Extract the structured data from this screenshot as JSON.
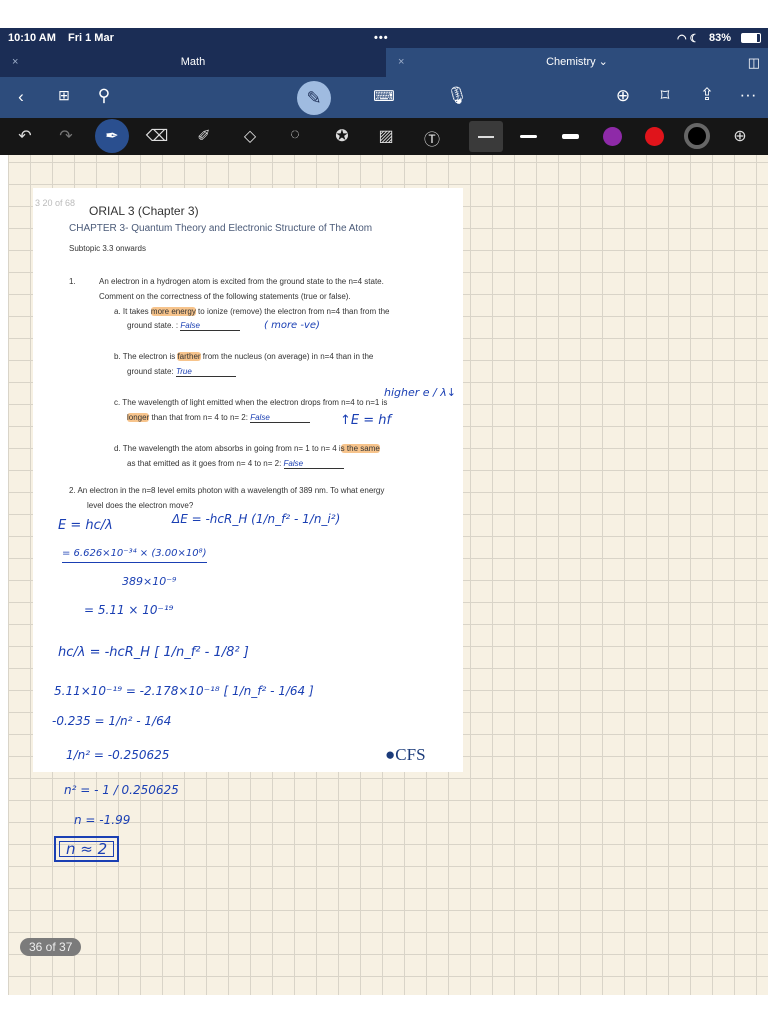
{
  "status": {
    "time": "10:10 AM",
    "date": "Fri 1 Mar",
    "battery": "83%"
  },
  "tabs": [
    {
      "label": "Math",
      "close": "×"
    },
    {
      "label": "Chemistry ⌄",
      "close": "×"
    }
  ],
  "toolbar_icons": [
    "back-icon",
    "grid-icon",
    "search-icon",
    "pencil-mode-icon",
    "keyboard-icon",
    "microphone-icon",
    "add-page-icon",
    "bookmark-icon",
    "share-icon",
    "more-icon"
  ],
  "drawing_tools": [
    "undo-icon",
    "redo-icon",
    "pen-icon",
    "eraser-icon",
    "highlighter-icon",
    "shapes-icon",
    "lasso-icon",
    "sticker-icon",
    "image-icon",
    "text-icon"
  ],
  "colors": {
    "purple": "#8e2aa8",
    "red": "#e0141b",
    "black": "#000000",
    "ink": "#1a3fb3",
    "highlight": "#f7c48c"
  },
  "document": {
    "page_ref": "3 20 of 68",
    "title": "ORIAL 3 (Chapter 3)",
    "chapter": "CHAPTER 3- Quantum Theory and Electronic Structure of The Atom",
    "subtopic": "Subtopic 3.3 onwards",
    "q1_num": "1.",
    "q1_line1": "An electron in a hydrogen atom is excited from the ground state to the n=4 state.",
    "q1_line2": "Comment on the correctness of the following statements (true or false).",
    "a_pre": "a.  It takes ",
    "a_hl": "more energy",
    "a_post": " to ionize (remove) the electron from n=4 than from the",
    "a_line2": "ground state. :",
    "a_ans": "False",
    "b_pre": "b.  The electron is ",
    "b_hl": "farther",
    "b_post": " from the nucleus (on average) in n=4 than in the",
    "b_line2": "ground state:",
    "b_ans": "True",
    "c_line1": "c.  The wavelength of light emitted when the electron drops from n=4 to n=1 is",
    "c_hl": "longer",
    "c_post": " than that from n= 4 to n= 2:",
    "c_ans": "False",
    "d_pre": "d.  The wavelength the atom absorbs in going from n= 1 to n= 4 i",
    "d_hl": "s the same",
    "d_line2": "as that emitted as it goes from n= 4 to n= 2:",
    "d_ans": "False",
    "q2_line1": "2.  An electron in the n=8 level emits photon with a wavelength of 389 nm. To what energy",
    "q2_line2": "level does the electron move?",
    "logo": "CFS"
  },
  "handwriting": {
    "note_a": "( more  -ve)",
    "note_c1": "higher e / λ↓",
    "note_c2": "↑E = hf",
    "eq1": "E = hc/λ",
    "eq2": "ΔE = -hcR_H (1/n_f² - 1/n_i²)",
    "eq3": "= 6.626×10⁻³⁴ × (3.00×10⁸)",
    "eq3b": "389×10⁻⁹",
    "eq4": "= 5.11 × 10⁻¹⁹",
    "eq5": "hc/λ = -hcR_H [ 1/n_f² - 1/8² ]",
    "eq6": "5.11×10⁻¹⁹  =  -2.178×10⁻¹⁸ [ 1/n_f² - 1/64 ]",
    "eq7": "-0.235  =  1/n² - 1/64",
    "eq8": "1/n² = -0.250625",
    "eq9": "n² = - 1 / 0.250625",
    "eq10": "n = -1.99",
    "eq11": "n ≈ 2"
  },
  "page_indicator": "36 of 37"
}
